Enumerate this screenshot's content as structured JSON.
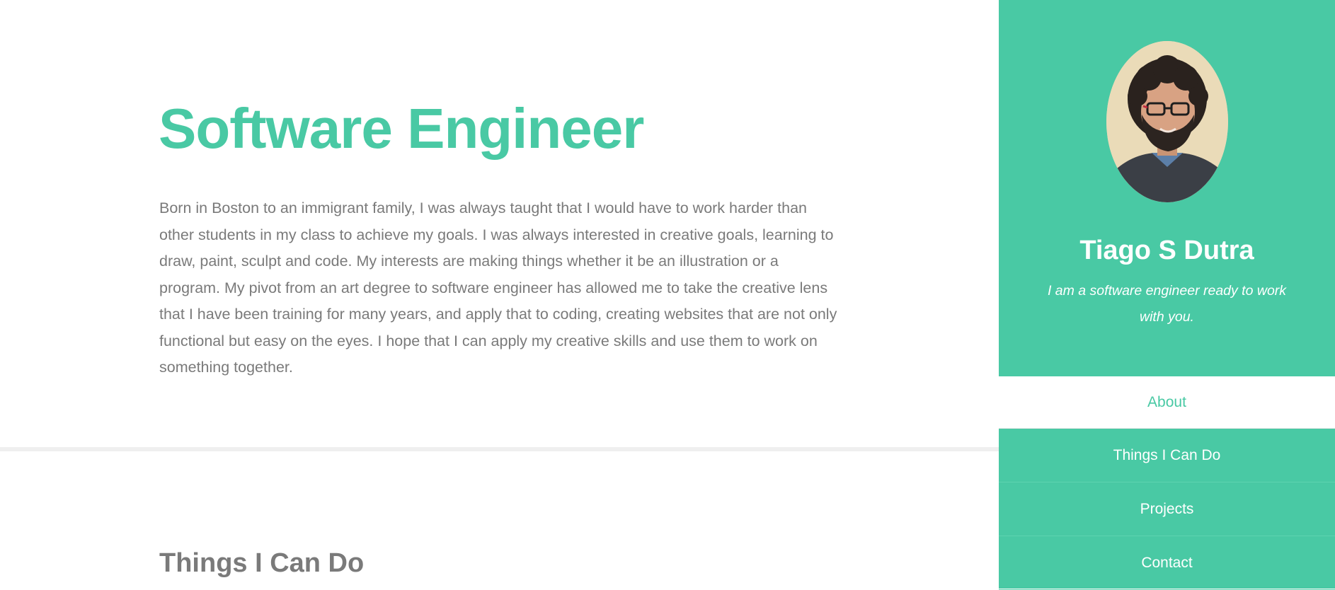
{
  "intro": {
    "title": "Software Engineer",
    "bio": "Born in Boston to an immigrant family, I was always taught that I would have to work harder than other students in my class to achieve my goals. I was always interested in creative goals, learning to draw, paint, sculpt and code. My interests are making things whether it be an illustration or a program. My pivot from an art degree to software engineer has allowed me to take the creative lens that I have been training for many years, and apply that to coding, creating websites that are not only functional but easy on the eyes. I hope that I can apply my creative skills and use them to work on something together."
  },
  "skills_section": {
    "title": "Things I Can Do"
  },
  "sidebar": {
    "name": "Tiago S Dutra",
    "tagline": "I am a software engineer ready to work with you.",
    "nav": [
      {
        "label": "About",
        "active": true
      },
      {
        "label": "Things I Can Do",
        "active": false
      },
      {
        "label": "Projects",
        "active": false
      },
      {
        "label": "Contact",
        "active": false
      }
    ]
  },
  "colors": {
    "accent": "#49c9a4",
    "body_text": "#7a7a7a",
    "divider": "#efefef"
  }
}
